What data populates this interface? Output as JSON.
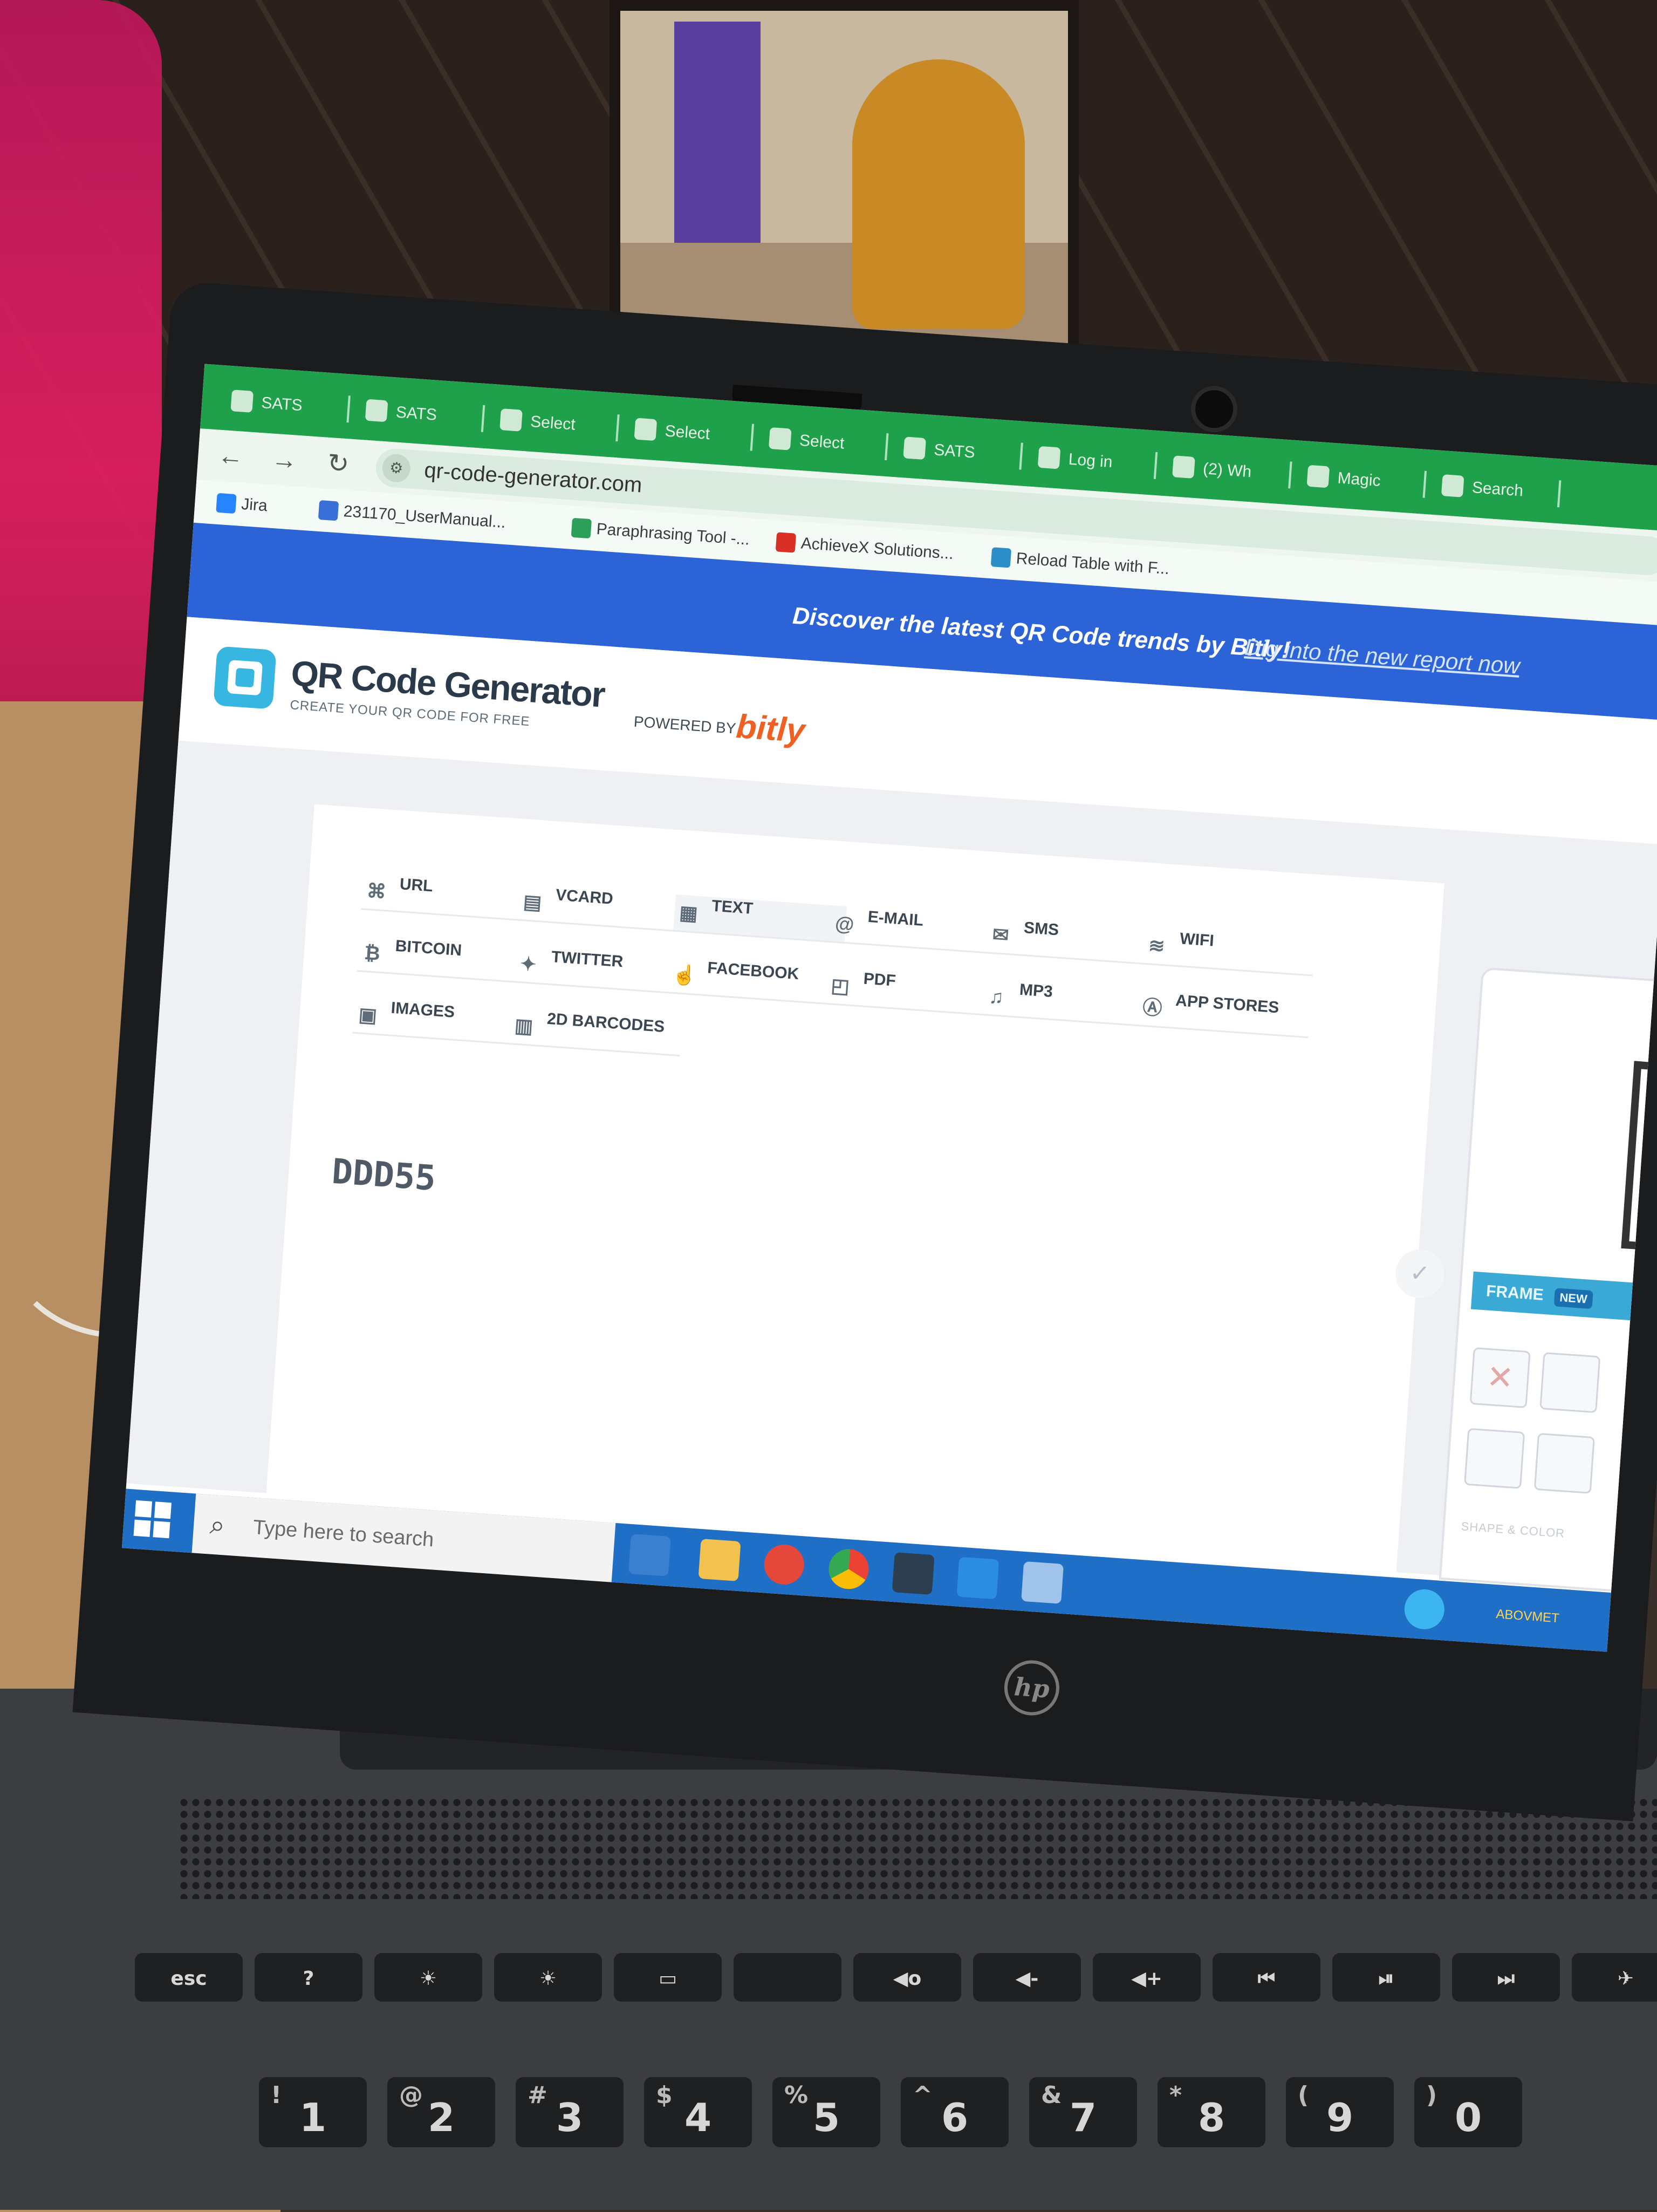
{
  "browser": {
    "tabs": [
      {
        "label": "SATS"
      },
      {
        "label": "SATS"
      },
      {
        "label": "Select"
      },
      {
        "label": "Select"
      },
      {
        "label": "Select"
      },
      {
        "label": "SATS"
      },
      {
        "label": "Log in"
      },
      {
        "label": "(2) Wh"
      },
      {
        "label": "Magic"
      },
      {
        "label": "Search"
      }
    ],
    "url": "qr-code-generator.com",
    "bookmarks": [
      {
        "label": "Jira",
        "color": "#2684ff"
      },
      {
        "label": "231170_UserManual...",
        "color": "#3a6fd8"
      },
      {
        "label": "Paraphrasing Tool -...",
        "color": "#2e9e5b"
      },
      {
        "label": "AchieveX Solutions...",
        "color": "#d93025"
      },
      {
        "label": "Reload Table with F...",
        "color": "#2c8ec9"
      }
    ]
  },
  "banner": {
    "headline": "Discover the latest QR Code trends by Bitly!",
    "link": "Dig into the new report now",
    "color": "#2c64d8"
  },
  "header": {
    "brand": "QR Code Generator",
    "tagline": "CREATE YOUR QR CODE FOR FREE",
    "powered_by": "POWERED BY",
    "partner": "bitly"
  },
  "qr_types": [
    {
      "label": "URL",
      "icon": "url-icon"
    },
    {
      "label": "VCARD",
      "icon": "vcard-icon"
    },
    {
      "label": "TEXT",
      "icon": "text-doc-icon"
    },
    {
      "label": "E-MAIL",
      "icon": "at-icon"
    },
    {
      "label": "SMS",
      "icon": "sms-icon"
    },
    {
      "label": "WIFI",
      "icon": "wifi-icon"
    },
    {
      "label": "BITCOIN",
      "icon": "bitcoin-icon"
    },
    {
      "label": "TWITTER",
      "icon": "twitter-icon"
    },
    {
      "label": "FACEBOOK",
      "icon": "thumbs-up-icon"
    },
    {
      "label": "PDF",
      "icon": "pdf-icon"
    },
    {
      "label": "MP3",
      "icon": "music-icon"
    },
    {
      "label": "APP STORES",
      "icon": "app-store-icon"
    },
    {
      "label": "IMAGES",
      "icon": "image-icon"
    },
    {
      "label": "2D BARCODES",
      "icon": "barcode-icon"
    }
  ],
  "active_type": "TEXT",
  "content_text": "DDD55",
  "preview": {
    "frame_label": "FRAME",
    "frame_badge": "NEW",
    "shape_label": "SHAPE & COLOR"
  },
  "taskbar": {
    "search_placeholder": "Type here to search",
    "tray_text": "ABOVMET"
  },
  "laptop": {
    "brand": "hp",
    "fn_keys": [
      "esc",
      "?",
      "☀",
      "☀",
      "▭",
      "",
      "◀ο",
      "◀-",
      "◀+",
      "⏮",
      "⏯",
      "⏭",
      "✈"
    ],
    "number_keys": [
      {
        "main": "1",
        "shift": "!"
      },
      {
        "main": "2",
        "shift": "@"
      },
      {
        "main": "3",
        "shift": "#"
      },
      {
        "main": "4",
        "shift": "$"
      },
      {
        "main": "5",
        "shift": "%"
      },
      {
        "main": "6",
        "shift": "^"
      },
      {
        "main": "7",
        "shift": "&"
      },
      {
        "main": "8",
        "shift": "*"
      },
      {
        "main": "9",
        "shift": "("
      },
      {
        "main": "0",
        "shift": ")"
      }
    ]
  }
}
